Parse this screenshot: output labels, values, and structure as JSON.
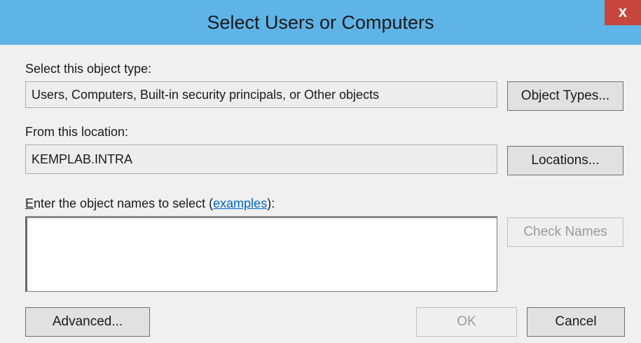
{
  "window": {
    "title": "Select Users or Computers",
    "close_label": "x"
  },
  "object_type": {
    "label": "Select this object type:",
    "value": "Users, Computers, Built-in security principals, or Other objects",
    "button": "Object Types..."
  },
  "location": {
    "label": "From this location:",
    "value": "KEMPLAB.INTRA",
    "button": "Locations..."
  },
  "names": {
    "label_first_letter": "E",
    "label_rest": "nter the object names to select (",
    "link": "examples",
    "label_end": "):",
    "value": "",
    "check_button": "Check Names"
  },
  "footer": {
    "advanced_button": "Advanced...",
    "ok_button": "OK",
    "cancel_button": "Cancel"
  },
  "colors": {
    "titlebar": "#5fb4e7",
    "close": "#c7463d",
    "link": "#0066cc"
  }
}
